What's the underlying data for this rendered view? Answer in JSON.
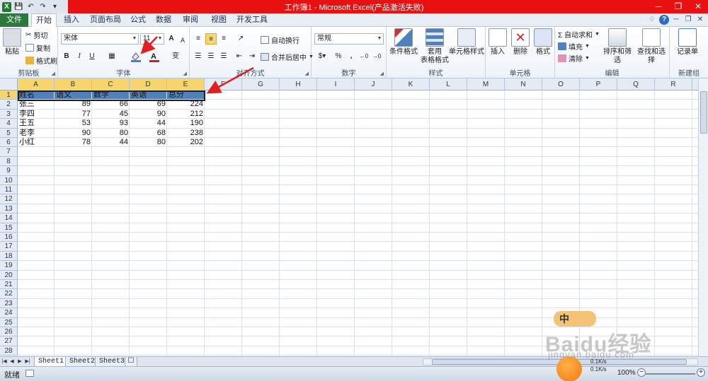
{
  "window": {
    "title": "工作簿1 - Microsoft Excel(产品激活失败)",
    "buttons": [
      "─",
      "❐",
      "✕"
    ]
  },
  "quick_access": [
    "X",
    "💾",
    "↶",
    "↷",
    "▾"
  ],
  "tabs": [
    {
      "label": "文件",
      "kind": "file"
    },
    {
      "label": "开始",
      "kind": "active"
    },
    {
      "label": "插入",
      "kind": "normal"
    },
    {
      "label": "页面布局",
      "kind": "normal"
    },
    {
      "label": "公式",
      "kind": "normal"
    },
    {
      "label": "数据",
      "kind": "normal"
    },
    {
      "label": "审阅",
      "kind": "normal"
    },
    {
      "label": "视图",
      "kind": "normal"
    },
    {
      "label": "开发工具",
      "kind": "normal"
    }
  ],
  "tab_right_icons": [
    "♢",
    "?",
    "─",
    "❐",
    "✕"
  ],
  "ribbon": {
    "clipboard": {
      "group_label": "剪贴板",
      "paste": "粘贴",
      "cut": "剪切",
      "copy": "复制",
      "format_painter": "格式刷"
    },
    "font": {
      "group_label": "字体",
      "font_name": "宋体",
      "font_size": "11",
      "grow": "A",
      "shrink": "A",
      "bold": "B",
      "italic": "I",
      "underline": "U",
      "wen": "变"
    },
    "alignment": {
      "group_label": "对齐方式",
      "wrap": "自动换行",
      "merge": "合并后居中"
    },
    "number": {
      "group_label": "数字",
      "format": "常规",
      "percent": "%",
      "comma": ","
    },
    "styles": {
      "group_label": "样式",
      "conditional": "条件格式",
      "table_line1": "套用",
      "table_line2": "表格格式",
      "cell_styles": "单元格样式"
    },
    "cells": {
      "group_label": "单元格",
      "insert": "插入",
      "delete": "删除",
      "format": "格式"
    },
    "editing": {
      "group_label": "编辑",
      "autosum": "Σ 自动求和",
      "fill": "填充",
      "clear": "清除",
      "sort_filter": "排序和筛选",
      "find_select": "查找和选择"
    },
    "new_group": {
      "group_label": "新建组",
      "record": "记录单"
    }
  },
  "columns": [
    "A",
    "B",
    "C",
    "D",
    "E",
    "F",
    "G",
    "H",
    "I",
    "J",
    "K",
    "L",
    "M",
    "N",
    "O",
    "P",
    "Q",
    "R"
  ],
  "row_numbers": [
    "1",
    "2",
    "3",
    "4",
    "5",
    "6",
    "7",
    "8",
    "9",
    "10",
    "11",
    "12",
    "13",
    "14",
    "15",
    "16",
    "17",
    "18",
    "19",
    "20",
    "21",
    "22",
    "23",
    "24",
    "25",
    "26",
    "27",
    "28"
  ],
  "highlight_color": "#4f81bd",
  "table": {
    "headers": [
      "姓名",
      "语文",
      "数学",
      "英语",
      "总分"
    ],
    "rows": [
      [
        "张三",
        "89",
        "66",
        "69",
        "224"
      ],
      [
        "李四",
        "77",
        "45",
        "90",
        "212"
      ],
      [
        "王五",
        "53",
        "93",
        "44",
        "190"
      ],
      [
        "老李",
        "90",
        "80",
        "68",
        "238"
      ],
      [
        "小红",
        "78",
        "44",
        "80",
        "202"
      ]
    ]
  },
  "sheets": [
    "Sheet1",
    "Sheet2",
    "Sheet3"
  ],
  "status": {
    "ready": "就绪",
    "zoom": "100%"
  },
  "watermark": {
    "ime": "中",
    "logo": "Baidu经验",
    "url": "jingyan.baidu.com",
    "rate_up": "0.1K/s",
    "rate_down": "0.1K/s"
  }
}
